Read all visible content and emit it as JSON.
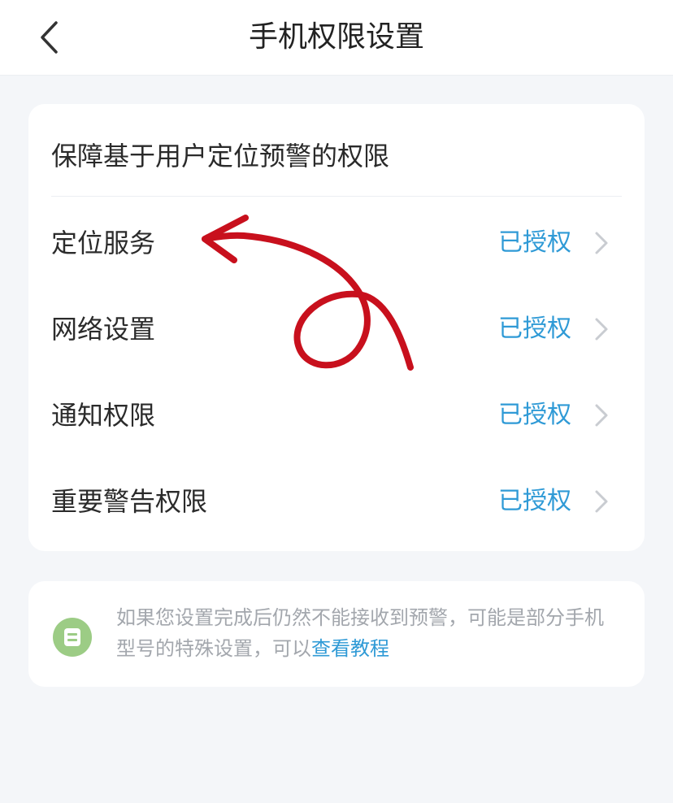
{
  "header": {
    "title": "手机权限设置",
    "back_icon": "chevron-left-icon"
  },
  "permissions": {
    "title": "保障基于用户定位预警的权限",
    "items": [
      {
        "label": "定位服务",
        "status": "已授权"
      },
      {
        "label": "网络设置",
        "status": "已授权"
      },
      {
        "label": "通知权限",
        "status": "已授权"
      },
      {
        "label": "重要警告权限",
        "status": "已授权"
      }
    ]
  },
  "tip": {
    "icon": "info-icon",
    "text": "如果您设置完成后仍然不能接收到预警，可能是部分手机型号的特殊设置，可以",
    "link": "查看教程"
  },
  "colors": {
    "accent": "#2f9ad6",
    "annotation": "#c8101d",
    "tip_icon_bg": "#9ccc85"
  }
}
